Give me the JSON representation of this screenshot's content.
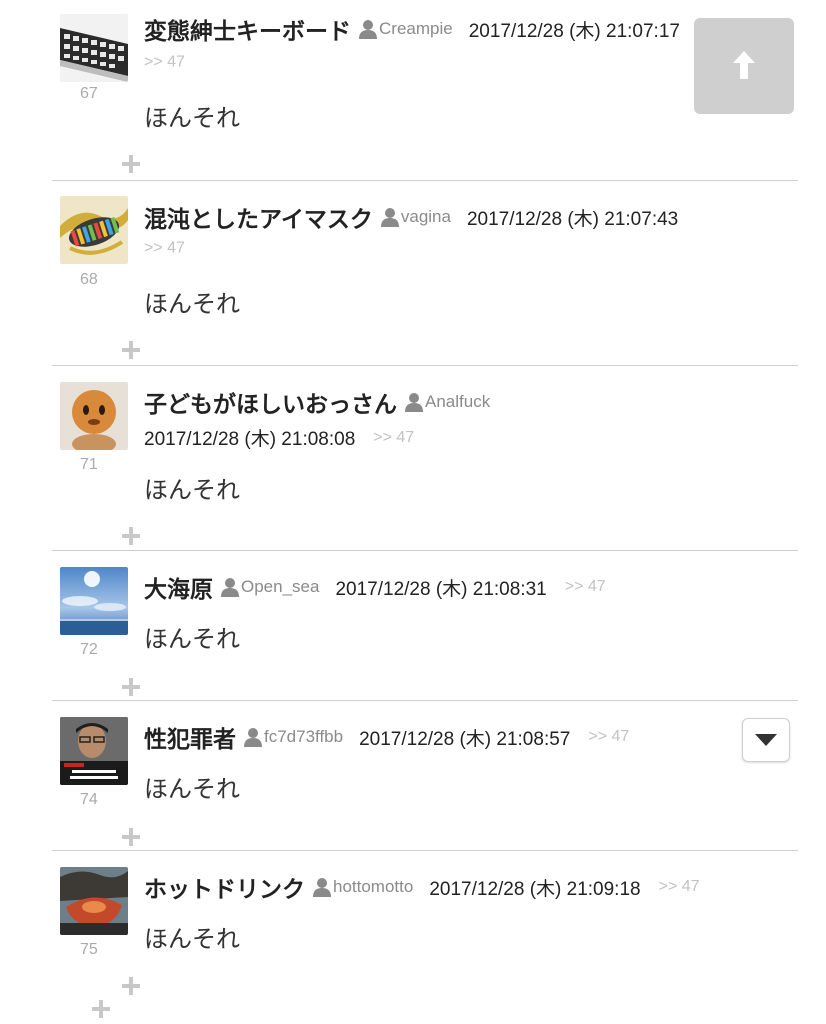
{
  "reply_marker": ">> 47",
  "posts": [
    {
      "number": "67",
      "name": "変態紳士キーボード",
      "user_id": "Creampie",
      "date": "2017/12/28 (木) 21:07:17",
      "body": "ほんそれ"
    },
    {
      "number": "68",
      "name": "混沌としたアイマスク",
      "user_id": "vagina",
      "date": "2017/12/28 (木) 21:07:43",
      "body": "ほんそれ"
    },
    {
      "number": "71",
      "name": "子どもがほしいおっさん",
      "user_id": "Analfuck",
      "date": "2017/12/28 (木) 21:08:08",
      "body": "ほんそれ"
    },
    {
      "number": "72",
      "name": "大海原",
      "user_id": "Open_sea",
      "date": "2017/12/28 (木) 21:08:31",
      "body": "ほんそれ"
    },
    {
      "number": "74",
      "name": "性犯罪者",
      "user_id": "fc7d73ffbb",
      "date": "2017/12/28 (木) 21:08:57",
      "body": "ほんそれ"
    },
    {
      "number": "75",
      "name": "ホットドリンク",
      "user_id": "hottomotto",
      "date": "2017/12/28 (木) 21:09:18",
      "body": "ほんそれ"
    }
  ],
  "icons": {
    "scroll_top": "arrow-up-icon",
    "dropdown": "triangle-down-icon",
    "add": "plus-icon",
    "user": "user-icon"
  },
  "colors": {
    "scroll_top_bg": "#cfcfcf",
    "muted_text": "#aaaaaa",
    "divider": "#cfcfcf"
  }
}
